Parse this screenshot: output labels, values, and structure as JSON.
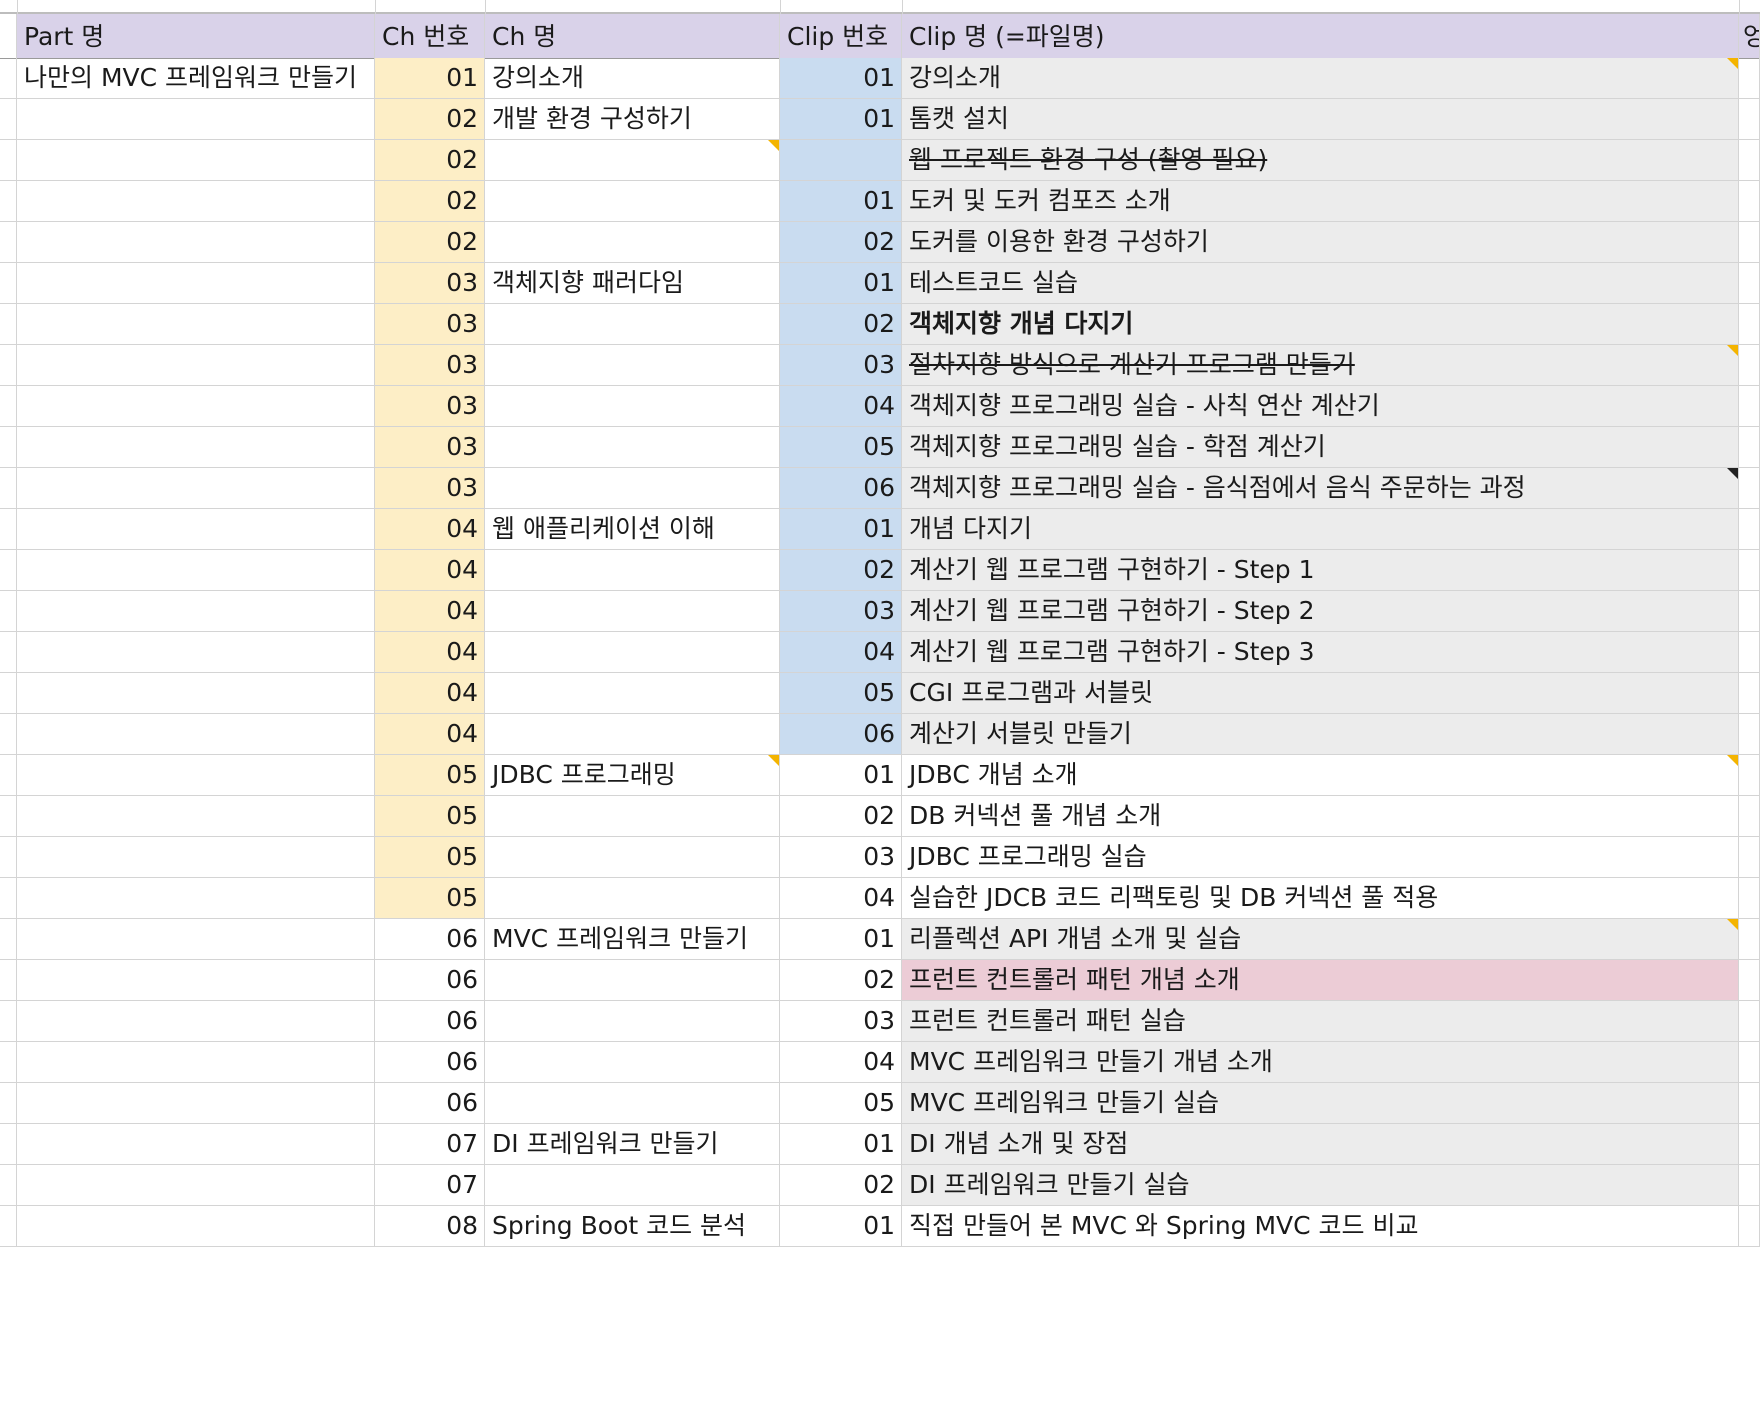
{
  "headers": {
    "part": "Part 명",
    "ch_no": "Ch 번호",
    "ch_name": "Ch 명",
    "clip_no": "Clip 번호",
    "clip_name": "Clip 명 (=파일명)",
    "ext": "엉"
  },
  "colors": {
    "header_bg": "#d9d2e9",
    "ch_highlight": "#fdeec6",
    "clip_highlight": "#c9dcf0",
    "clip_name_gray": "#ececec",
    "clip_name_pink": "#ecccd6",
    "note_marker": "#f4b400"
  },
  "rows": [
    {
      "part": "나만의 MVC 프레임워크 만들기",
      "ch_no": "01",
      "ch_name": "강의소개",
      "clip_no": "01",
      "clip_name": "강의소개",
      "ch_bg": "yellow",
      "clip_bg": "blue",
      "name_bg": "gray",
      "note_name": "yellow"
    },
    {
      "part": "",
      "ch_no": "02",
      "ch_name": "개발 환경 구성하기",
      "clip_no": "01",
      "clip_name": "톰캣 설치",
      "ch_bg": "yellow",
      "clip_bg": "blue",
      "name_bg": "gray"
    },
    {
      "part": "",
      "ch_no": "02",
      "ch_name": "",
      "clip_no": "",
      "clip_name": "웹 프로젝트 환경 구성 (촬영 필요)",
      "ch_bg": "yellow",
      "clip_bg": "blue",
      "name_bg": "gray",
      "strike": true,
      "note_chname": "yellow"
    },
    {
      "part": "",
      "ch_no": "02",
      "ch_name": "",
      "clip_no": "01",
      "clip_name": "도커 및 도커 컴포즈 소개",
      "ch_bg": "yellow",
      "clip_bg": "blue",
      "name_bg": "gray"
    },
    {
      "part": "",
      "ch_no": "02",
      "ch_name": "",
      "clip_no": "02",
      "clip_name": "도커를 이용한 환경 구성하기",
      "ch_bg": "yellow",
      "clip_bg": "blue",
      "name_bg": "gray"
    },
    {
      "part": "",
      "ch_no": "03",
      "ch_name": "객체지향 패러다임",
      "clip_no": "01",
      "clip_name": "테스트코드 실습",
      "ch_bg": "yellow",
      "clip_bg": "blue",
      "name_bg": "gray"
    },
    {
      "part": "",
      "ch_no": "03",
      "ch_name": "",
      "clip_no": "02",
      "clip_name": "객체지향 개념 다지기",
      "ch_bg": "yellow",
      "clip_bg": "blue",
      "name_bg": "gray",
      "bold": true
    },
    {
      "part": "",
      "ch_no": "03",
      "ch_name": "",
      "clip_no": "03",
      "clip_name": "절차지향 방식으로 계산기 프로그램 만들기",
      "ch_bg": "yellow",
      "clip_bg": "blue",
      "name_bg": "gray",
      "strike": true,
      "note_name": "yellow"
    },
    {
      "part": "",
      "ch_no": "03",
      "ch_name": "",
      "clip_no": "04",
      "clip_name": "객체지향 프로그래밍 실습 - 사칙 연산 계산기",
      "ch_bg": "yellow",
      "clip_bg": "blue",
      "name_bg": "gray"
    },
    {
      "part": "",
      "ch_no": "03",
      "ch_name": "",
      "clip_no": "05",
      "clip_name": "객체지향 프로그래밍 실습 - 학점 계산기",
      "ch_bg": "yellow",
      "clip_bg": "blue",
      "name_bg": "gray"
    },
    {
      "part": "",
      "ch_no": "03",
      "ch_name": "",
      "clip_no": "06",
      "clip_name": "객체지향 프로그래밍 실습 - 음식점에서 음식 주문하는 과정",
      "ch_bg": "yellow",
      "clip_bg": "blue",
      "name_bg": "gray",
      "note_name": "dark"
    },
    {
      "part": "",
      "ch_no": "04",
      "ch_name": "웹 애플리케이션 이해",
      "clip_no": "01",
      "clip_name": "개념 다지기",
      "ch_bg": "yellow",
      "clip_bg": "blue",
      "name_bg": "gray"
    },
    {
      "part": "",
      "ch_no": "04",
      "ch_name": "",
      "clip_no": "02",
      "clip_name": "계산기 웹 프로그램 구현하기 - Step 1",
      "ch_bg": "yellow",
      "clip_bg": "blue",
      "name_bg": "gray"
    },
    {
      "part": "",
      "ch_no": "04",
      "ch_name": "",
      "clip_no": "03",
      "clip_name": "계산기 웹 프로그램 구현하기  - Step 2",
      "ch_bg": "yellow",
      "clip_bg": "blue",
      "name_bg": "gray"
    },
    {
      "part": "",
      "ch_no": "04",
      "ch_name": "",
      "clip_no": "04",
      "clip_name": "계산기 웹 프로그램 구현하기 - Step 3",
      "ch_bg": "yellow",
      "clip_bg": "blue",
      "name_bg": "gray"
    },
    {
      "part": "",
      "ch_no": "04",
      "ch_name": "",
      "clip_no": "05",
      "clip_name": "CGI 프로그램과 서블릿",
      "ch_bg": "yellow",
      "clip_bg": "blue",
      "name_bg": "gray"
    },
    {
      "part": "",
      "ch_no": "04",
      "ch_name": "",
      "clip_no": "06",
      "clip_name": "계산기 서블릿 만들기",
      "ch_bg": "yellow",
      "clip_bg": "blue",
      "name_bg": "gray"
    },
    {
      "part": "",
      "ch_no": "05",
      "ch_name": "JDBC 프로그래밍",
      "clip_no": "01",
      "clip_name": "JDBC 개념 소개",
      "ch_bg": "yellow",
      "clip_bg": "",
      "name_bg": "",
      "note_chname": "yellow",
      "note_name": "yellow"
    },
    {
      "part": "",
      "ch_no": "05",
      "ch_name": "",
      "clip_no": "02",
      "clip_name": "DB 커넥션 풀 개념 소개",
      "ch_bg": "yellow",
      "clip_bg": "",
      "name_bg": ""
    },
    {
      "part": "",
      "ch_no": "05",
      "ch_name": "",
      "clip_no": "03",
      "clip_name": "JDBC 프로그래밍 실습",
      "ch_bg": "yellow",
      "clip_bg": "",
      "name_bg": ""
    },
    {
      "part": "",
      "ch_no": "05",
      "ch_name": "",
      "clip_no": "04",
      "clip_name": "실습한 JDCB 코드 리팩토링 및 DB 커넥션 풀 적용",
      "ch_bg": "yellow",
      "clip_bg": "",
      "name_bg": ""
    },
    {
      "part": "",
      "ch_no": "06",
      "ch_name": "MVC 프레임워크 만들기",
      "clip_no": "01",
      "clip_name": "리플렉션 API 개념 소개 및 실습",
      "ch_bg": "",
      "clip_bg": "",
      "name_bg": "gray",
      "note_name": "yellow"
    },
    {
      "part": "",
      "ch_no": "06",
      "ch_name": "",
      "clip_no": "02",
      "clip_name": "프런트 컨트롤러 패턴 개념 소개",
      "ch_bg": "",
      "clip_bg": "",
      "name_bg": "pink"
    },
    {
      "part": "",
      "ch_no": "06",
      "ch_name": "",
      "clip_no": "03",
      "clip_name": "프런트 컨트롤러 패턴 실습",
      "ch_bg": "",
      "clip_bg": "",
      "name_bg": "gray"
    },
    {
      "part": "",
      "ch_no": "06",
      "ch_name": "",
      "clip_no": "04",
      "clip_name": "MVC 프레임워크 만들기 개념 소개",
      "ch_bg": "",
      "clip_bg": "",
      "name_bg": "gray"
    },
    {
      "part": "",
      "ch_no": "06",
      "ch_name": "",
      "clip_no": "05",
      "clip_name": "MVC 프레임워크 만들기 실습",
      "ch_bg": "",
      "clip_bg": "",
      "name_bg": "gray"
    },
    {
      "part": "",
      "ch_no": "07",
      "ch_name": "DI 프레임워크 만들기",
      "clip_no": "01",
      "clip_name": "DI 개념 소개 및 장점",
      "ch_bg": "",
      "clip_bg": "",
      "name_bg": "gray"
    },
    {
      "part": "",
      "ch_no": "07",
      "ch_name": "",
      "clip_no": "02",
      "clip_name": "DI 프레임워크 만들기 실습",
      "ch_bg": "",
      "clip_bg": "",
      "name_bg": "gray"
    },
    {
      "part": "",
      "ch_no": "08",
      "ch_name": "Spring Boot 코드 분석",
      "clip_no": "01",
      "clip_name": "직접 만들어 본 MVC 와 Spring MVC 코드 비교",
      "ch_bg": "",
      "clip_bg": "",
      "name_bg": ""
    }
  ]
}
